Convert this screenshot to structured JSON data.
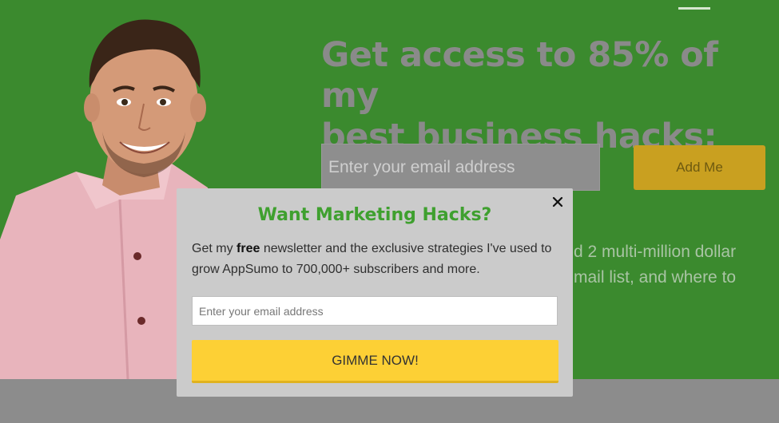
{
  "hero": {
    "headline_line1": "Get access to 85% of my",
    "headline_line2": "best business hacks:",
    "email_placeholder": "Enter your email address",
    "add_me_label": "Add Me",
    "body_line1": "d 2 multi-million dollar",
    "body_line2": "mail list, and where to"
  },
  "modal": {
    "title": "Want Marketing Hacks?",
    "text_before": "Get my ",
    "text_bold": "free",
    "text_after": " newsletter and the exclusive strategies I've used to grow AppSumo to 700,000+ subscribers and more.",
    "email_placeholder": "Enter your email address",
    "submit_label": "GIMME NOW!",
    "close_icon": "close-icon"
  },
  "colors": {
    "hero_bg": "#3b8a2e",
    "modal_bg": "#cbcbcb",
    "title_green": "#3fa02f",
    "button_yellow": "#fdd035"
  }
}
